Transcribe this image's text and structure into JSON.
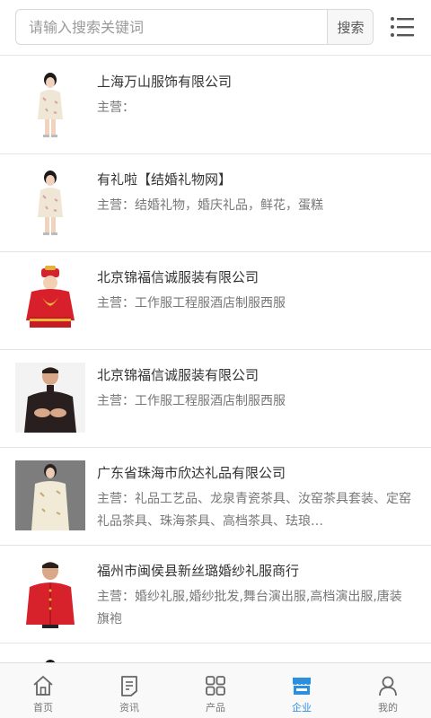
{
  "search": {
    "placeholder": "请输入搜索关键词",
    "button_label": "搜索"
  },
  "list": {
    "biz_prefix": "主营：",
    "items": [
      {
        "name": "上海万山服饰有限公司",
        "business": ""
      },
      {
        "name": "有礼啦【结婚礼物网】",
        "business": "结婚礼物，婚庆礼品，鲜花，蛋糕"
      },
      {
        "name": "北京锦福信诚服装有限公司",
        "business": "工作服工程服酒店制服西服"
      },
      {
        "name": "北京锦福信诚服装有限公司",
        "business": "工作服工程服酒店制服西服"
      },
      {
        "name": "广东省珠海市欣达礼品有限公司",
        "business": "礼品工艺品、龙泉青瓷茶具、汝窑茶具套装、定窑礼品茶具、珠海茶具、高档茶具、珐琅…"
      },
      {
        "name": "福州市闽侯县新丝璐婚纱礼服商行",
        "business": "婚纱礼服,婚纱批发,舞台演出服,高档演出服,唐装旗袍"
      }
    ]
  },
  "nav": {
    "items": [
      {
        "label": "首页",
        "icon": "home-icon"
      },
      {
        "label": "资讯",
        "icon": "news-icon"
      },
      {
        "label": "产品",
        "icon": "products-icon"
      },
      {
        "label": "企业",
        "icon": "enterprise-icon",
        "active": true
      },
      {
        "label": "我的",
        "icon": "user-icon"
      }
    ]
  },
  "colors": {
    "accent": "#2b8fe0",
    "text": "#333333",
    "muted": "#777777"
  }
}
